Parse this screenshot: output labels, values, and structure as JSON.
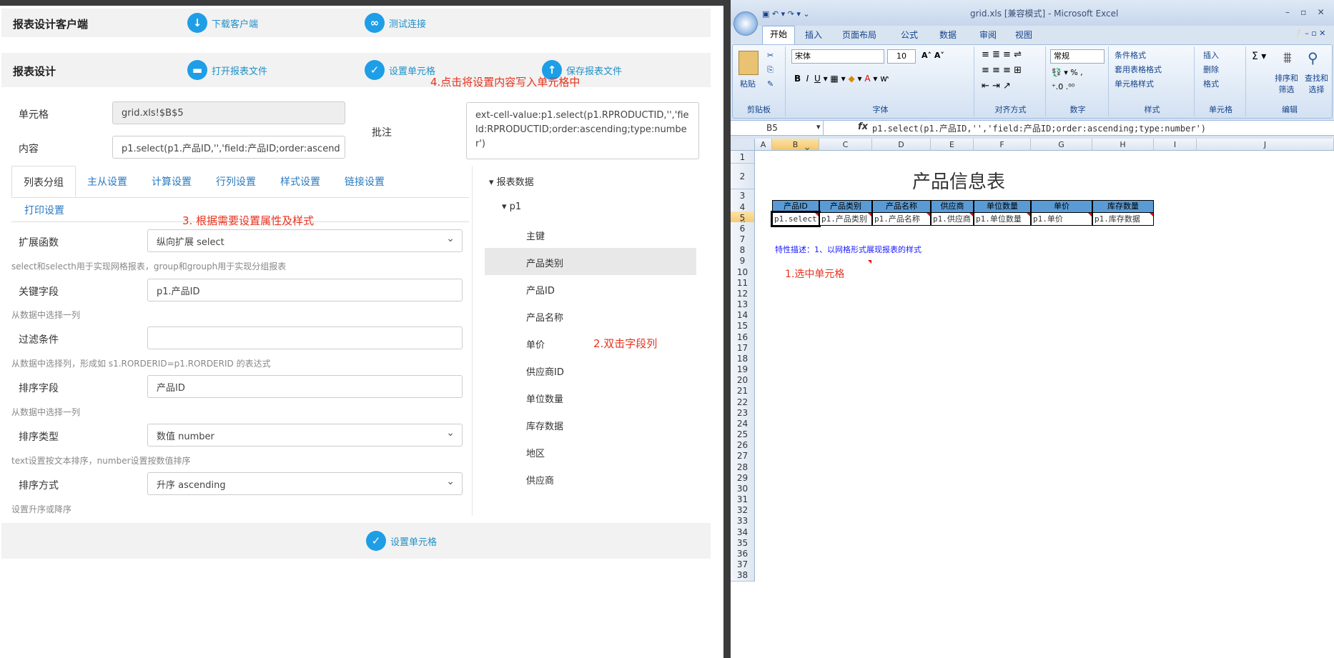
{
  "left": {
    "bar1": {
      "title": "报表设计客户端",
      "download": "下载客户端",
      "test": "测试连接"
    },
    "bar2": {
      "title": "报表设计",
      "open": "打开报表文件",
      "setcell": "设置单元格",
      "save": "保存报表文件",
      "note4": "4.点击将设置内容写入单元格中"
    },
    "form": {
      "cell_label": "单元格",
      "cell_value": "grid.xls!$B$5",
      "content_label": "内容",
      "content_value": "p1.select(p1.产品ID,'','field:产品ID;order:ascend",
      "comment_label": "批注",
      "comment_value": "ext-cell-value:p1.select(p1.RPRODUCTID,'','field:RPRODUCTID;order:ascending;type:number')"
    },
    "tabs": [
      "列表分组",
      "主从设置",
      "计算设置",
      "行列设置",
      "样式设置",
      "链接设置"
    ],
    "print_tab": "打印设置",
    "note3": "3. 根据需要设置属性及样式",
    "props": [
      {
        "label": "扩展函数",
        "value": "纵向扩展 select",
        "hint": "select和selecth用于实现网格报表，group和grouph用于实现分组报表"
      },
      {
        "label": "关键字段",
        "value": "p1.产品ID",
        "hint": "从数据中选择一列"
      },
      {
        "label": "过滤条件",
        "value": "",
        "hint": "从数据中选择列，形成如 s1.RORDERID=p1.RORDERID 的表达式"
      },
      {
        "label": "排序字段",
        "value": "产品ID",
        "hint": "从数据中选择一列"
      },
      {
        "label": "排序类型",
        "value": "数值 number",
        "hint": "text设置按文本排序，number设置按数值排序"
      },
      {
        "label": "排序方式",
        "value": "升序 ascending",
        "hint": "设置升序或降序"
      }
    ],
    "tree": {
      "root": "报表数据",
      "ds": "p1",
      "fields": [
        "主键",
        "产品类别",
        "产品ID",
        "产品名称",
        "单价",
        "供应商ID",
        "单位数量",
        "库存数据",
        "地区",
        "供应商"
      ],
      "note2": "2.双击字段列"
    },
    "bottom_button": "设置单元格"
  },
  "excel": {
    "title": "grid.xls [兼容模式] - Microsoft Excel",
    "tabs": [
      "开始",
      "插入",
      "页面布局",
      "公式",
      "数据",
      "审阅",
      "视图"
    ],
    "groups": [
      "剪贴板",
      "字体",
      "对齐方式",
      "数字",
      "样式",
      "单元格",
      "编辑"
    ],
    "paste": "粘贴",
    "font_name": "宋体",
    "font_size": "10",
    "num_format": "常规",
    "style_items": [
      "条件格式",
      "套用表格格式",
      "单元格样式"
    ],
    "cell_items": [
      "插入",
      "删除",
      "格式"
    ],
    "edit_items": [
      "排序和\n筛选",
      "查找和\n选择"
    ],
    "name_box": "B5",
    "formula": "p1.select(p1.产品ID,'','field:产品ID;order:ascending;type:number')",
    "columns": [
      "A",
      "B",
      "C",
      "D",
      "E",
      "F",
      "G",
      "H",
      "I",
      "J"
    ],
    "sheet_title": "产品信息表",
    "headers": [
      "产品ID",
      "产品类别",
      "产品名称",
      "供应商",
      "单位数量",
      "单价",
      "库存数量"
    ],
    "row5": [
      "p1.select(",
      "p1.产品类别",
      "p1.产品名称",
      "p1.供应商",
      "p1.单位数量",
      "p1.单价",
      "p1.库存数据"
    ],
    "desc": "特性描述：1、以网格形式展现报表的样式",
    "note1": "1.选中单元格"
  },
  "colors": {
    "accent": "#1e9ee6",
    "note": "#e8321e",
    "header_fill": "#5a9bd5"
  }
}
